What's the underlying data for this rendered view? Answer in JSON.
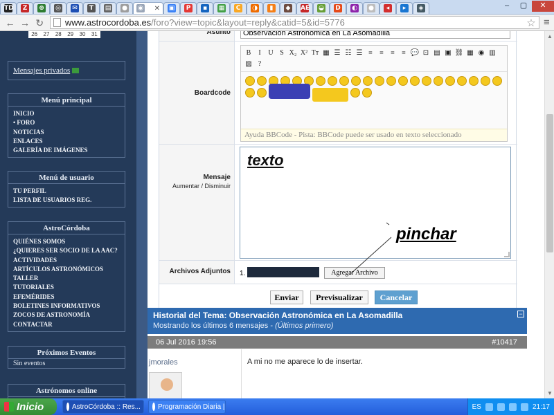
{
  "browser": {
    "tabs": [
      {
        "icon": "TD",
        "color": "#222222"
      },
      {
        "icon": "Z",
        "color": "#c62828"
      },
      {
        "icon": "⊕",
        "color": "#2e7d32"
      },
      {
        "icon": "◎",
        "color": "#555555"
      },
      {
        "icon": "✉",
        "color": "#1e4fb4"
      },
      {
        "icon": "T",
        "color": "#555555"
      },
      {
        "icon": "▤",
        "color": "#666666"
      },
      {
        "icon": "●",
        "color": "#9e9e9e"
      }
    ],
    "active_tab_icon": "◉",
    "tabs_after": [
      {
        "icon": "▣",
        "color": "#3b82f6"
      },
      {
        "icon": "P",
        "color": "#e53935"
      },
      {
        "icon": "▪",
        "color": "#1565c0"
      },
      {
        "icon": "▦",
        "color": "#43a047"
      },
      {
        "icon": "C",
        "color": "#f9a825"
      },
      {
        "icon": "◑",
        "color": "#ef6c00"
      },
      {
        "icon": "▮",
        "color": "#f57f17"
      },
      {
        "icon": "◆",
        "color": "#6d4c41"
      },
      {
        "icon": "AE",
        "color": "#c62828"
      },
      {
        "icon": "◒",
        "color": "#689f38"
      },
      {
        "icon": "D",
        "color": "#e64a19"
      },
      {
        "icon": "◐",
        "color": "#8e24aa"
      },
      {
        "icon": "●",
        "color": "#bdbdbd"
      },
      {
        "icon": "◂",
        "color": "#d32f2f"
      },
      {
        "icon": "▸",
        "color": "#1976d2"
      },
      {
        "icon": "◈",
        "color": "#455a64"
      }
    ],
    "url_host": "www.astrocordoba.es",
    "url_path": "/foro?view=topic&layout=reply&catid=5&id=5776",
    "window_controls": [
      "‒",
      "▢",
      "✕"
    ]
  },
  "sidebar": {
    "calendar_days": [
      "26",
      "27",
      "28",
      "29",
      "30",
      "31"
    ],
    "private_messages": "Mensajes privados",
    "main_menu": {
      "title": "Menú principal",
      "items": [
        "INICIO",
        "• FORO",
        "NOTICIAS",
        "ENLACES",
        "GALERÍA DE IMÁGENES"
      ]
    },
    "user_menu": {
      "title": "Menú de usuario",
      "items": [
        "TU PERFIL",
        "LISTA DE USUARIOS REG."
      ]
    },
    "astro_menu": {
      "title": "AstroCórdoba",
      "items": [
        "QUIÉNES SOMOS",
        "¿QUIERES SER SOCIO DE LA AAC?",
        "ACTIVIDADES",
        "ARTÍCULOS ASTRONÓMICOS",
        "TALLER",
        "TUTORIALES",
        "EFEMÉRIDES",
        "BOLETINES INFORMATIVOS",
        "ZOCOS DE ASTRONOMÍA",
        "CONTACTAR"
      ]
    },
    "events": {
      "title": "Próximos Eventos",
      "text": "Sin eventos"
    },
    "online": {
      "title": "Astrónomos online"
    }
  },
  "form": {
    "subject_label": "Asunto",
    "subject_value": "Observación Astronómica en La Asomadilla",
    "boardcode_label": "Boardcode",
    "bb_buttons": [
      "B",
      "I",
      "U",
      "S",
      "X₂",
      "X²",
      "Tт",
      "▦",
      "☰",
      "☷",
      "☰",
      "≡",
      "≡",
      "≡",
      "≡",
      "💬",
      "⊡",
      "▤",
      "▣",
      "⛓",
      "▦",
      "◉",
      "▥",
      "▨",
      "?"
    ],
    "bb_help": "Ayuda BBCode - Pista: BBCode puede ser usado en texto seleccionado",
    "message_label": "Mensaje",
    "increase_label": "Aumentar /",
    "decrease_label": "Disminuir",
    "message_text": "texto",
    "annotation": "pinchar",
    "attachments_label": "Archivos Adjuntos",
    "attachment_index": "1.",
    "add_file": "Agregar Archivo",
    "submit": "Enviar",
    "preview": "Previsualizar",
    "cancel": "Cancelar"
  },
  "history": {
    "title": "Historial del Tema: Observación Astronómica en La Asomadilla",
    "subtitle": "Mostrando los últimos 6 mensajes - ",
    "subtitle_em": "(Últimos primero)",
    "post_date": "06 Jul 2016 19:56",
    "post_number": "#10417",
    "author": "jmorales",
    "body": "A mi no me aparece lo de insertar."
  },
  "taskbar": {
    "start": "Inicio",
    "items": [
      "AstroCórdoba :: Res...",
      "Programación Diaria |..."
    ],
    "lang": "ES",
    "clock": "21:17"
  }
}
